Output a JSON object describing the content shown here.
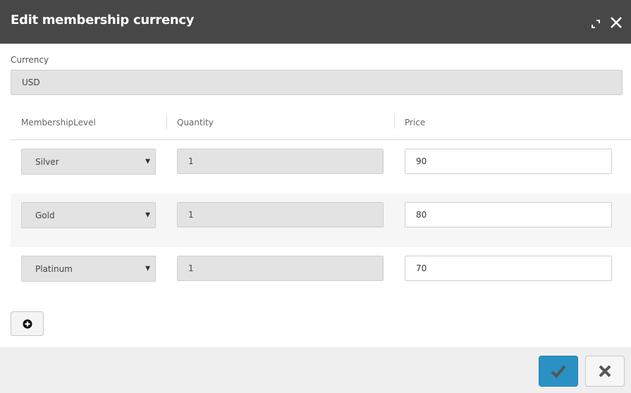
{
  "dialog": {
    "title": "Edit membership currency",
    "expand_icon": "expand-icon",
    "close_icon": "close-icon"
  },
  "currency": {
    "label": "Currency",
    "value": "USD"
  },
  "table": {
    "columns": [
      "MembershipLevel",
      "Quantity",
      "Price"
    ],
    "rows": [
      {
        "level": "Silver",
        "quantity": "1",
        "price": "90"
      },
      {
        "level": "Gold",
        "quantity": "1",
        "price": "80"
      },
      {
        "level": "Platinum",
        "quantity": "1",
        "price": "70"
      }
    ]
  },
  "actions": {
    "add_icon": "plus-circle-icon",
    "ok_icon": "checkmark-icon",
    "cancel_icon": "x-icon"
  },
  "colors": {
    "header_bg": "#474747",
    "primary": "#2a91c4",
    "footer_bg": "#efefef",
    "readonly_bg": "#e3e3e3"
  }
}
